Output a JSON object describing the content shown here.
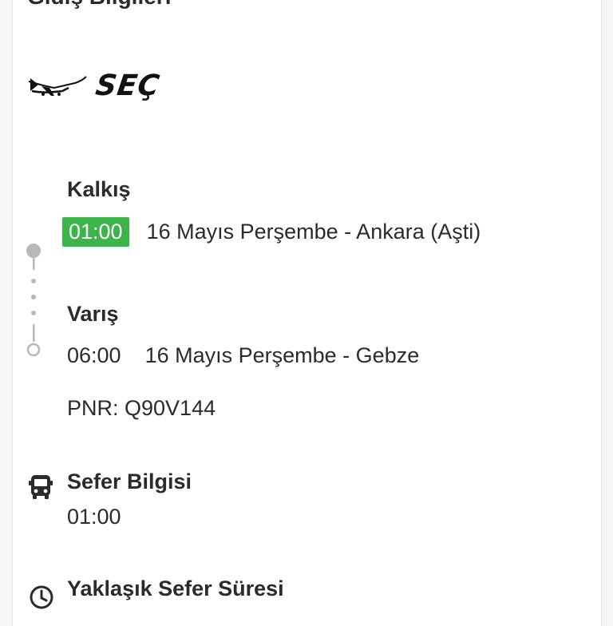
{
  "section": {
    "title": "Gidiş Bilgileri"
  },
  "operator": {
    "logo_text": "SEÇ",
    "logo_icon": "airplane-logo-icon"
  },
  "departure": {
    "label": "Kalkış",
    "time": "01:00",
    "detail": "16 Mayıs Perşembe - Ankara (Aşti)",
    "badge_color": "#3bb54a"
  },
  "arrival": {
    "label": "Varış",
    "time": "06:00",
    "detail": "16 Mayıs Perşembe - Gebze"
  },
  "pnr": {
    "text": "PNR: Q90V144"
  },
  "trip_info": {
    "icon": "bus-icon",
    "label": "Sefer Bilgisi",
    "value": "01:00"
  },
  "duration": {
    "icon": "clock-icon",
    "label": "Yaklaşık Sefer Süresi"
  }
}
